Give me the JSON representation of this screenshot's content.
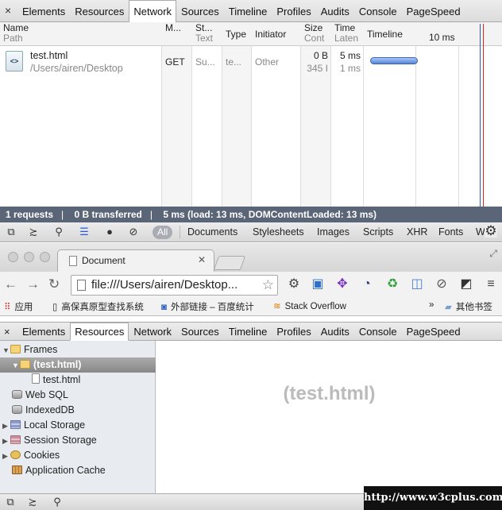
{
  "devtools_top": {
    "close": "×",
    "tabs": [
      "Elements",
      "Resources",
      "Network",
      "Sources",
      "Timeline",
      "Profiles",
      "Audits",
      "Console",
      "PageSpeed"
    ],
    "active_tab": "Network"
  },
  "network": {
    "headers": {
      "name": "Name",
      "name_sub": "Path",
      "method": "M...",
      "status": "St...",
      "status_sub": "Text",
      "type": "Type",
      "initiator": "Initiator",
      "size": "Size",
      "size_sub": "Cont",
      "time": "Time",
      "time_sub": "Laten",
      "timeline": "Timeline",
      "tick": "10 ms"
    },
    "rows": [
      {
        "name": "test.html",
        "path": "/Users/airen/Desktop",
        "method": "GET",
        "status": "Su...",
        "type": "te...",
        "initiator": "Other",
        "size": "0 B",
        "content": "345 I",
        "time": "5 ms",
        "latency": "1 ms",
        "icon": "html-file-icon"
      }
    ]
  },
  "status": {
    "requests": "1 requests",
    "transferred": "0 B transferred",
    "timing": "5 ms (load: 13 ms, DOMContentLoaded: 13 ms)"
  },
  "filterbar": {
    "all": "All",
    "types": [
      "Documents",
      "Stylesheets",
      "Images",
      "Scripts",
      "XHR",
      "Fonts",
      "W"
    ]
  },
  "browser": {
    "tab_title": "Document",
    "url": "file:///Users/airen/Desktop...",
    "bookmarks": [
      {
        "label": "应用",
        "icon": "apps-grid-icon"
      },
      {
        "label": "高保真原型查找系统",
        "icon": "page-icon"
      },
      {
        "label": "外部链接 – 百度统计",
        "icon": "chart-icon"
      },
      {
        "label": "Stack Overflow",
        "icon": "stackoverflow-icon"
      }
    ],
    "more": "»",
    "other_bookmarks": "其他书签"
  },
  "devtools_bottom": {
    "close": "×",
    "tabs": [
      "Elements",
      "Resources",
      "Network",
      "Sources",
      "Timeline",
      "Profiles",
      "Audits",
      "Console",
      "PageSpeed"
    ],
    "active_tab": "Resources",
    "tree": {
      "frames": "Frames",
      "frame_sel": "(test.html)",
      "frame_file": "test.html",
      "websql": "Web SQL",
      "indexeddb": "IndexedDB",
      "local_storage": "Local Storage",
      "session_storage": "Session Storage",
      "cookies": "Cookies",
      "app_cache": "Application Cache"
    },
    "placeholder": "(test.html)"
  },
  "watermark": "http://www.w3cplus.com"
}
